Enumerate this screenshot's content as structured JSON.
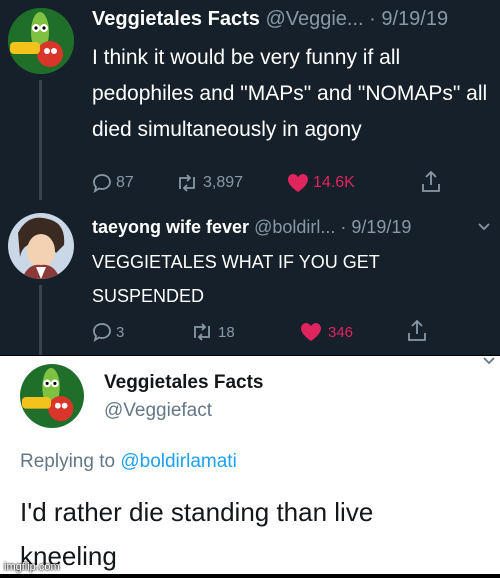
{
  "tweet1": {
    "display_name": "Veggietales Facts",
    "handle_date": "@Veggie... · 9/19/19",
    "avatar_text": "VeggieTales",
    "text": "I think it would be very funny if all pedophiles and \"MAPs\" and \"NOMAPs\" all died simultaneously in agony",
    "replies": "87",
    "retweets": "3,897",
    "likes": "14.6K"
  },
  "tweet2": {
    "display_name": "taeyong wife fever",
    "handle_date": "@boldirl... · 9/19/19",
    "text": "VEGGIETALES WHAT IF YOU GET SUSPENDED",
    "replies": "3",
    "retweets": "18",
    "likes": "346"
  },
  "reply": {
    "display_name": "Veggietales Facts",
    "handle": "@Veggiefact",
    "avatar_text": "VeggieTales",
    "replying_prefix": "Replying to",
    "replying_handle": "@boldirlamati",
    "text": "I'd rather die standing than live kneeling"
  },
  "watermark": "imgflip.com",
  "colors": {
    "dark_bg": "#15202b",
    "muted": "#8899a6",
    "like": "#e0245e",
    "link": "#1da1f2"
  },
  "icons": [
    "reply-icon",
    "retweet-icon",
    "heart-icon",
    "share-icon",
    "chevron-down-icon"
  ]
}
